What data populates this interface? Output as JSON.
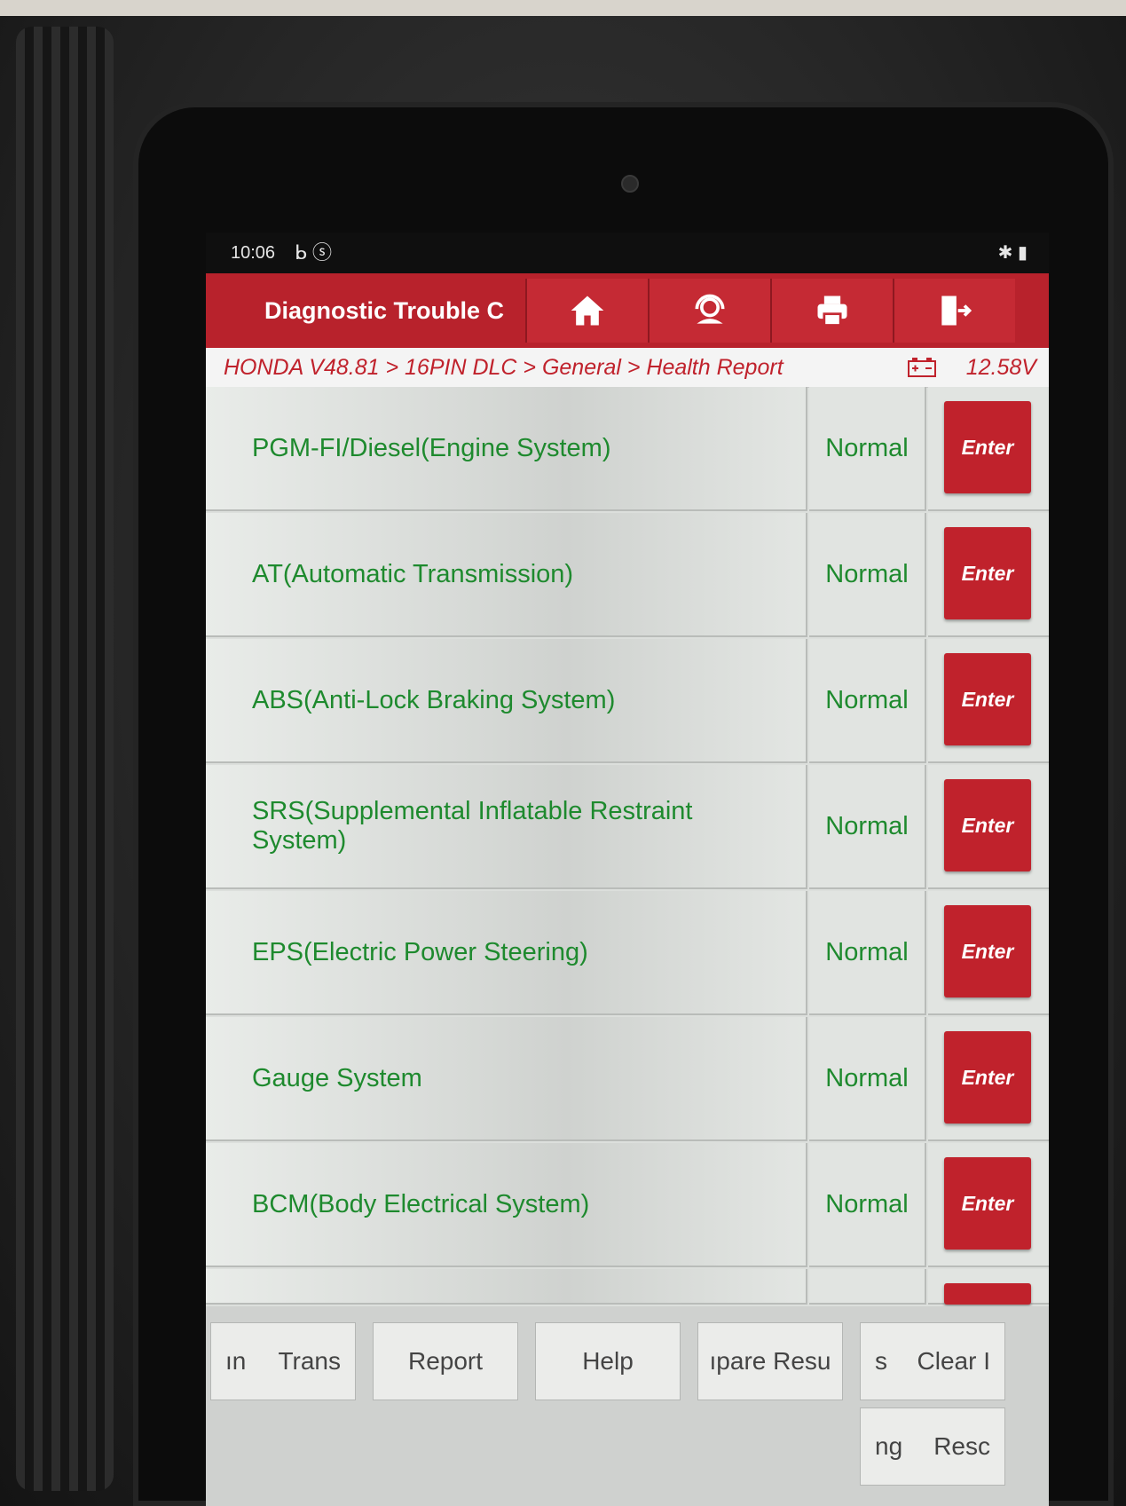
{
  "status_bar": {
    "time": "10:06",
    "left_icons": "ᖯ ⓢ",
    "right_icons": "✱ ▮"
  },
  "header": {
    "title": "Diagnostic Trouble C",
    "buttons": [
      {
        "name": "home",
        "icon": "home-icon"
      },
      {
        "name": "support",
        "icon": "headset-icon"
      },
      {
        "name": "print",
        "icon": "printer-icon"
      },
      {
        "name": "exit",
        "icon": "exit-icon"
      }
    ],
    "accent_color": "#b8222c"
  },
  "breadcrumb": {
    "path": "HONDA V48.81 > 16PIN DLC > General > Health Report",
    "voltage": "12.58V"
  },
  "systems": [
    {
      "name": "PGM-FI/Diesel(Engine System)",
      "status": "Normal",
      "action": "Enter"
    },
    {
      "name": "AT(Automatic Transmission)",
      "status": "Normal",
      "action": "Enter"
    },
    {
      "name": "ABS(Anti-Lock Braking System)",
      "status": "Normal",
      "action": "Enter"
    },
    {
      "name": "SRS(Supplemental Inflatable Restraint System)",
      "status": "Normal",
      "action": "Enter"
    },
    {
      "name": "EPS(Electric Power Steering)",
      "status": "Normal",
      "action": "Enter"
    },
    {
      "name": "Gauge System",
      "status": "Normal",
      "action": "Enter"
    },
    {
      "name": "BCM(Body Electrical System)",
      "status": "Normal",
      "action": "Enter"
    }
  ],
  "footer": {
    "btn1_left": "ın",
    "btn1_right": "Trans",
    "report": "Report",
    "help": "Help",
    "compare": "ıpare Resu",
    "btn5_left": "s",
    "btn5_right": "Clear I",
    "btn6_left": "ng",
    "btn6_right": "Resc"
  }
}
